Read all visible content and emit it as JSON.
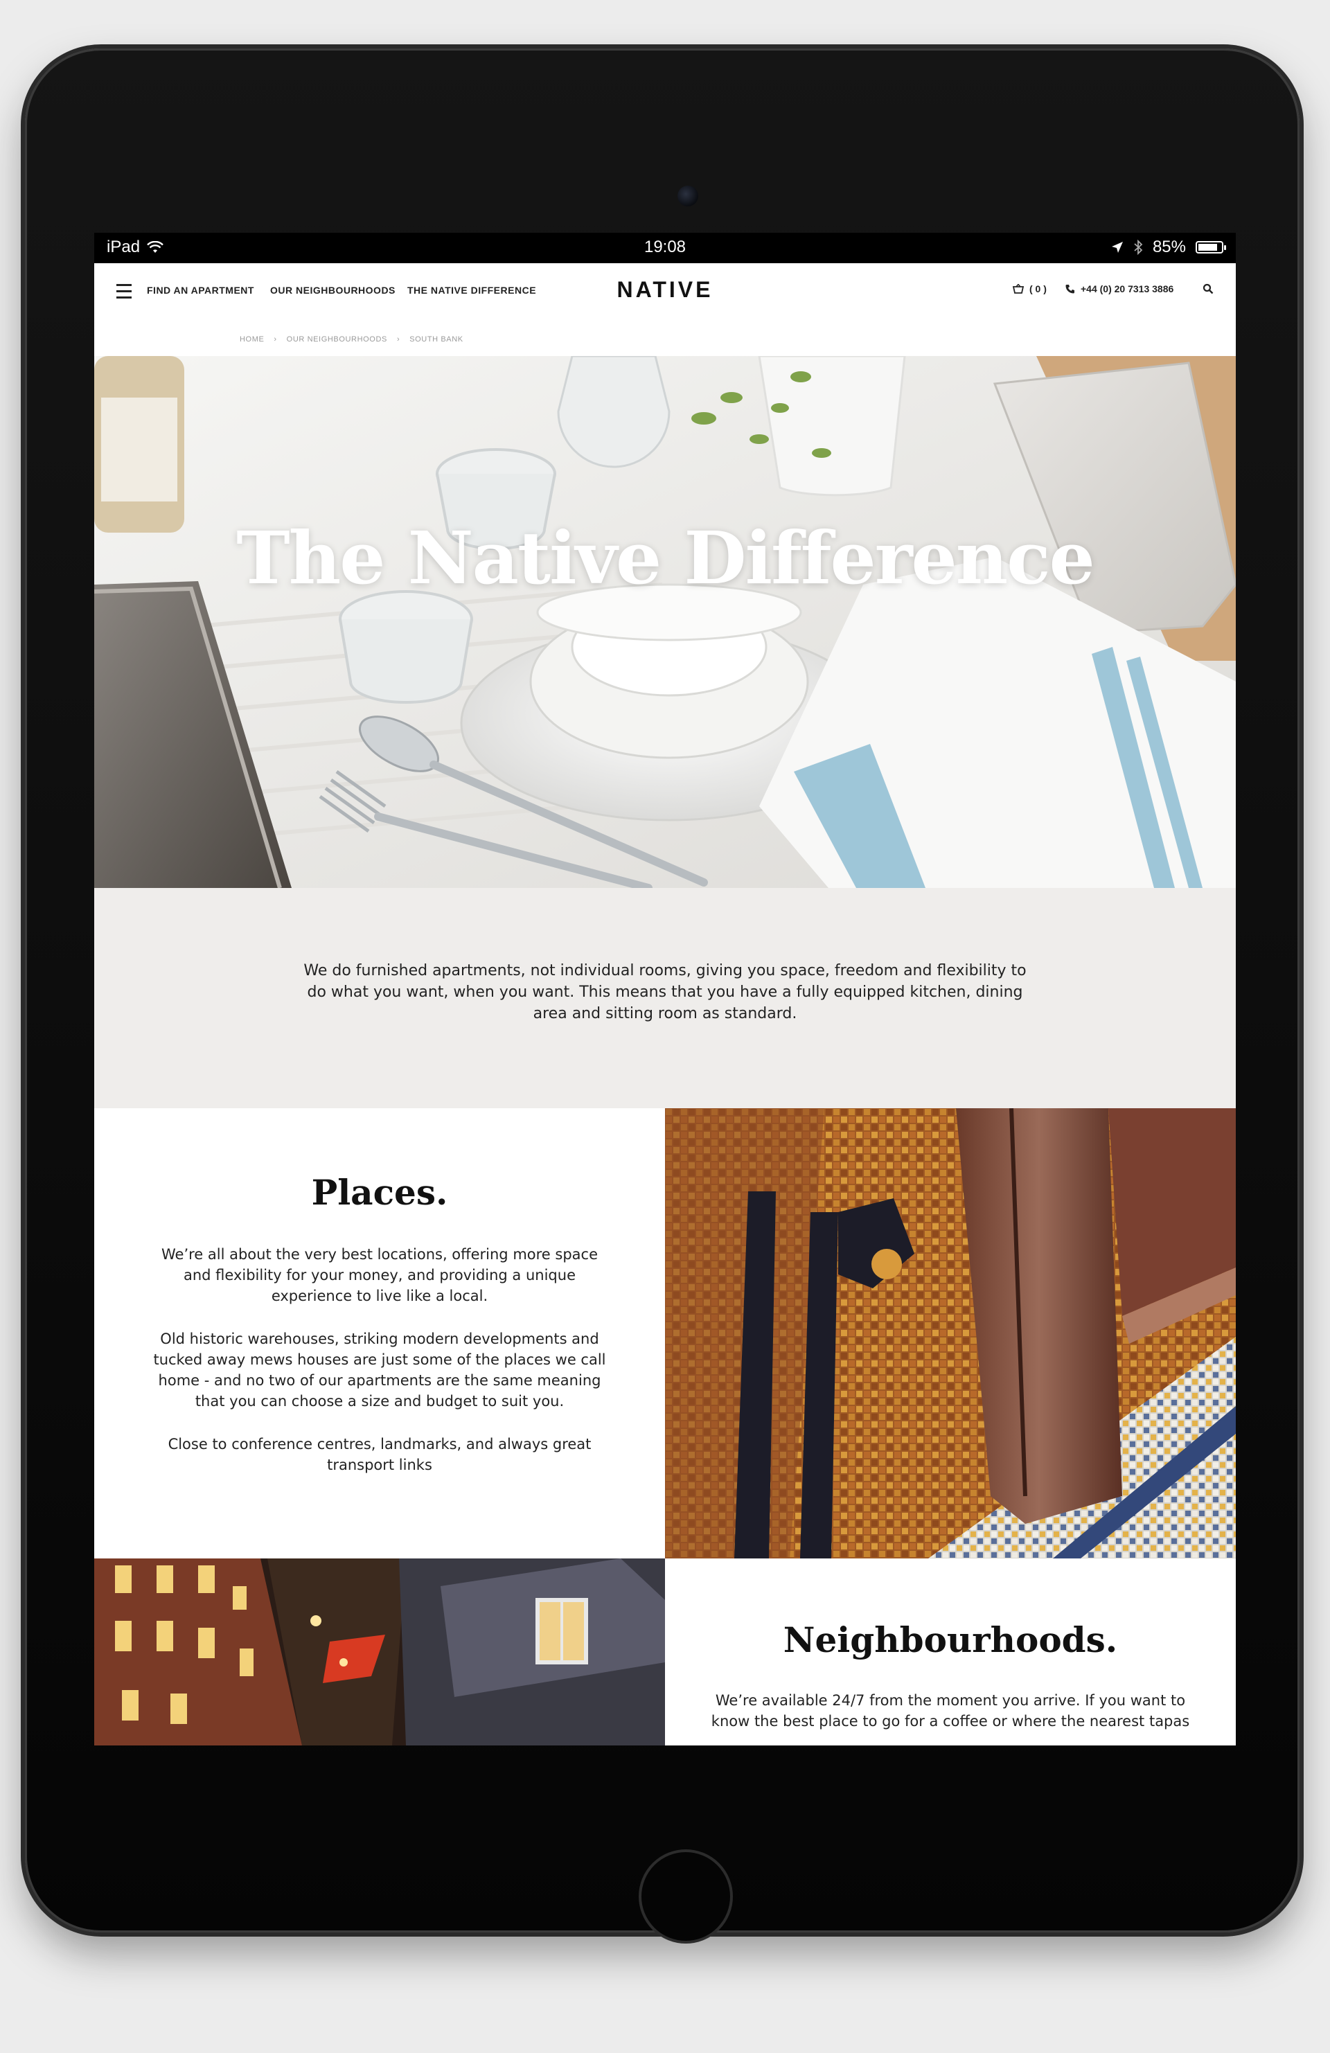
{
  "status_bar": {
    "device": "iPad",
    "time": "19:08",
    "battery": "85%",
    "battery_level": 0.85
  },
  "nav": {
    "links": [
      "FIND AN APARTMENT",
      "OUR NEIGHBOURHOODS",
      "THE NATIVE DIFFERENCE"
    ],
    "logo": "NATIVE",
    "basket": "( 0 )",
    "phone": "+44 (0) 20 7313 3886"
  },
  "breadcrumb": [
    "HOME",
    "OUR NEIGHBOURHOODS",
    "SOUTH BANK"
  ],
  "hero": {
    "title": "The Native Difference"
  },
  "intro": {
    "text": "We do furnished apartments, not individual rooms, giving you space, freedom and flexibility to do what you want, when you want. This means that you have a fully equipped kitchen, dining area and sitting room as standard."
  },
  "places": {
    "heading": "Places.",
    "paragraphs": [
      "We’re all about the very best locations, offering more space and flexibility for your money, and providing a unique experience to live like a local.",
      "Old historic warehouses, striking modern developments and tucked away mews houses are just some of the places we call home - and no two of our apartments are the same meaning that you can choose a size and budget to suit you.",
      "Close to conference centres, landmarks, and always great transport links"
    ]
  },
  "neighbourhoods": {
    "heading": "Neighbourhoods.",
    "text": "We’re available 24/7 from the moment you arrive. If you want to know the best place to go for a coffee or where the nearest tapas"
  }
}
